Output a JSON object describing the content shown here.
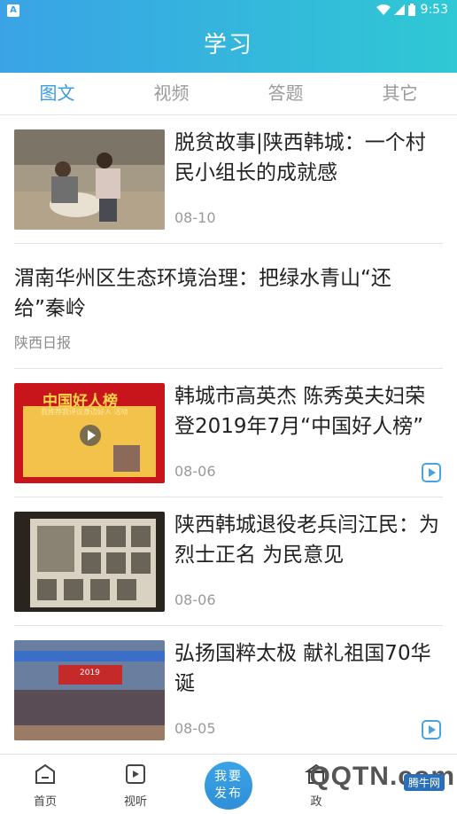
{
  "status": {
    "time": "9:53",
    "left_badge": "A"
  },
  "header": {
    "title": "学习"
  },
  "tabs": [
    {
      "label": "图文"
    },
    {
      "label": "视频"
    },
    {
      "label": "答题"
    },
    {
      "label": "其它"
    }
  ],
  "articles": [
    {
      "title": "脱贫故事|陕西韩城：一个村民小组长的成就感",
      "date": "08-10"
    },
    {
      "title": "渭南华州区生态环境治理：把绿水青山“还给”秦岭",
      "source": "陕西日报"
    },
    {
      "title": "韩城市高英杰 陈秀英夫妇荣登2019年7月“中国好人榜”",
      "date": "08-06",
      "thumb_text": "中国好人榜",
      "thumb_sub": "我推荐我评议身边好人 活动"
    },
    {
      "title": "陕西韩城退役老兵闫江民：为烈士正名 为民意见",
      "date": "08-06"
    },
    {
      "title": "弘扬国粹太极 献礼祖国70华诞",
      "date": "08-05",
      "thumb_text": "2019"
    }
  ],
  "bottom_nav": {
    "home": "首页",
    "listen": "视听",
    "publish_line1": "我要",
    "publish_line2": "发布",
    "fourth": "政",
    "watermark": "QQTN.com",
    "watermark_small": "腾牛网"
  },
  "colors": {
    "accent": "#3a9ee4",
    "header_start": "#3aa3e6",
    "header_end": "#2fc8d4"
  }
}
